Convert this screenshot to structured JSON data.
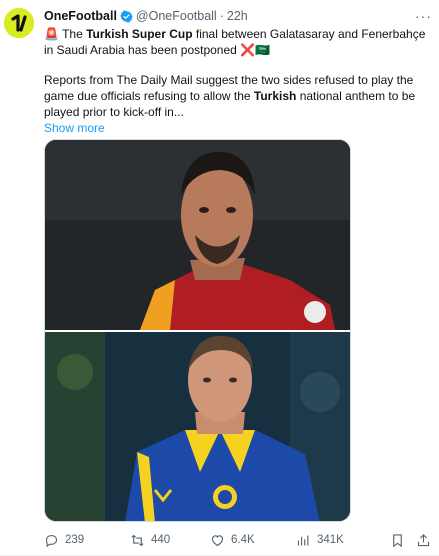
{
  "tweet": {
    "author_name": "OneFootball",
    "handle": "@OneFootball",
    "separator": "·",
    "time": "22h",
    "more": "···",
    "body": {
      "line1_emoji": "🚨",
      "line1_pre": "The ",
      "line1_bold": "Turkish Super Cup",
      "line1_post": " final between Galatasaray and Fenerbahçe in Saudi Arabia has been postponed",
      "line1_end_emoji": "❌🇸🇦",
      "para2_pre": "Reports from The Daily Mail suggest the two sides refused to play the game due officials refusing to allow the ",
      "para2_bold": "Turkish",
      "para2_post": " national anthem to be played prior to kick-off in..."
    },
    "show_more": "Show more",
    "avatar_icon": "onefootball-logo-icon",
    "verified_icon": "verified-badge-icon",
    "colors": {
      "brand": "#d7ec22",
      "link": "#1d9bf0",
      "muted": "#536471",
      "verified": "#1d9bf0"
    }
  },
  "actions": {
    "replies": "239",
    "retweets": "440",
    "likes": "6.4K",
    "views": "341K"
  }
}
